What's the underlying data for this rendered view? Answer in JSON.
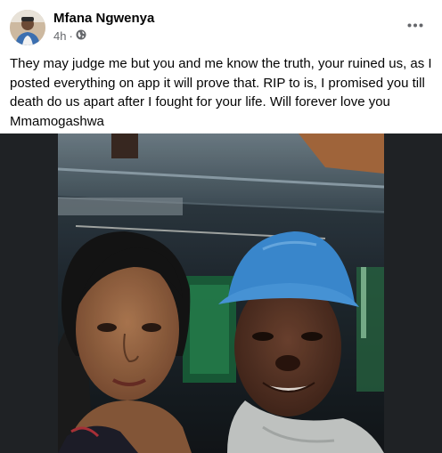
{
  "post": {
    "author": "Mfana Ngwenya",
    "time": "4h",
    "separator": "·",
    "audience_icon": "globe-icon",
    "more_icon": "more-horizontal-icon",
    "text": "They may judge me but you and me know the truth, your ruined us, as I posted everything on app it will prove that. RIP to is, I promised you till death do us apart after I fought for your life. Will forever love you Mmamogashwa"
  },
  "colors": {
    "text": "#050505",
    "meta": "#65676b",
    "photo_background": "#1f2225",
    "cap": "#3d8ed6"
  }
}
